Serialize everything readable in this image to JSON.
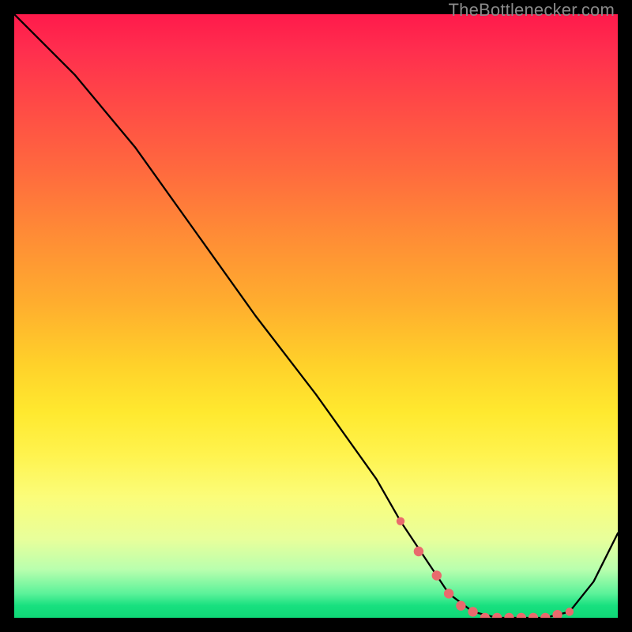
{
  "attribution": "TheBottlenecker.com",
  "colors": {
    "gradient_top": "#ff1a4b",
    "gradient_bottom": "#0fd877",
    "curve": "#000000",
    "marker": "#e96a6d",
    "background": "#000000"
  },
  "chart_data": {
    "type": "line",
    "title": "",
    "xlabel": "",
    "ylabel": "",
    "xlim": [
      0,
      100
    ],
    "ylim": [
      0,
      100
    ],
    "legend": false,
    "grid": false,
    "series": [
      {
        "name": "bottleneck-curve",
        "x": [
          0,
          6,
          10,
          20,
          30,
          40,
          50,
          60,
          64,
          68,
          72,
          76,
          80,
          84,
          88,
          92,
          96,
          100
        ],
        "y": [
          100,
          94,
          90,
          78,
          64,
          50,
          37,
          23,
          16,
          10,
          4,
          1,
          0,
          0,
          0,
          1,
          6,
          14
        ]
      }
    ],
    "markers": {
      "name": "highlighted-range",
      "x": [
        64,
        67,
        70,
        72,
        74,
        76,
        78,
        80,
        82,
        84,
        86,
        88,
        90,
        92
      ],
      "y": [
        16,
        11,
        7,
        4,
        2,
        1,
        0,
        0,
        0,
        0,
        0,
        0,
        0.5,
        1
      ]
    }
  }
}
